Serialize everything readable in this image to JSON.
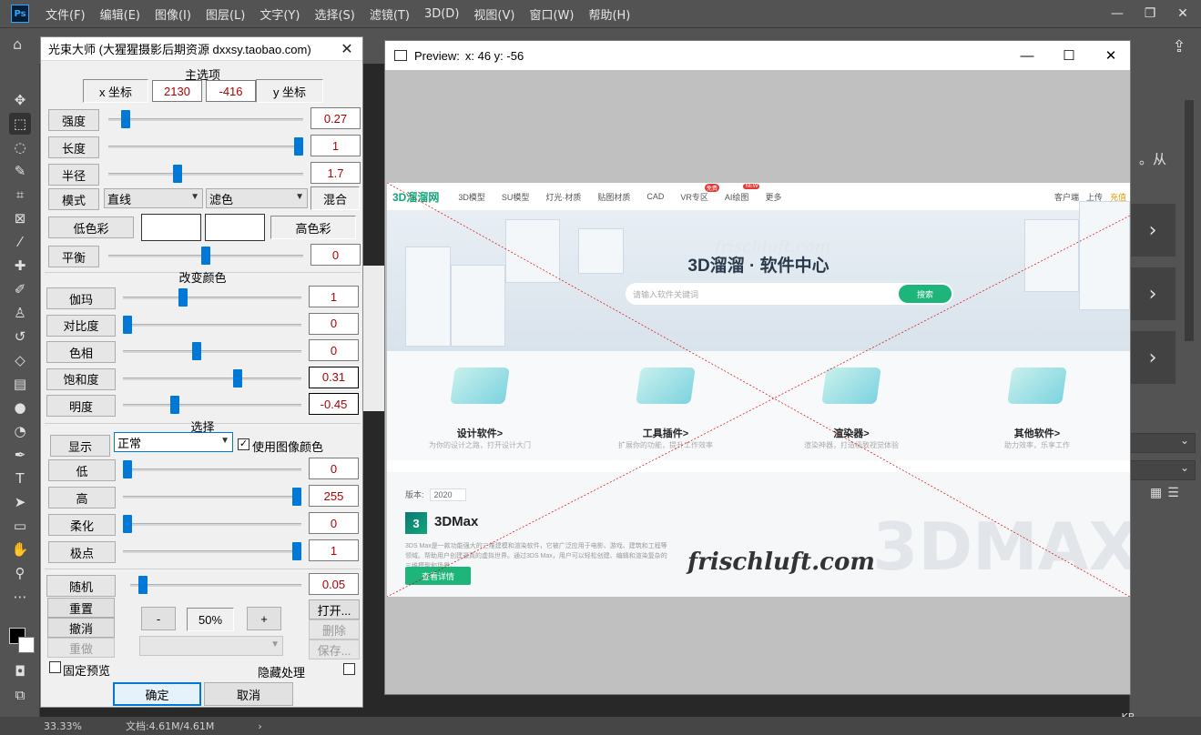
{
  "app": {
    "logo": "Ps",
    "menu": [
      "文件(F)",
      "编辑(E)",
      "图像(I)",
      "图层(L)",
      "文字(Y)",
      "选择(S)",
      "滤镜(T)",
      "3D(D)",
      "视图(V)",
      "窗口(W)",
      "帮助(H)"
    ],
    "window_controls": {
      "minimize": "—",
      "restore": "❐",
      "close": "✕"
    }
  },
  "right_panel": {
    "text": "。从",
    "arrow": "›",
    "kb": "— KB"
  },
  "status": {
    "zoom": "33.33%",
    "doc": "文档:4.61M/4.61M",
    "chevron": "›"
  },
  "dialog": {
    "title": "光束大师 (大猩猩摄影后期资源 dxxsy.taobao.com)",
    "close": "✕",
    "main_section": "主选项",
    "x_label": "x 坐标",
    "x_value": "2130",
    "y_value": "-416",
    "y_label": "y 坐标",
    "params": [
      {
        "label": "强度",
        "value": "0.27",
        "level": 0.07
      },
      {
        "label": "长度",
        "value": "1",
        "level": 1.0
      },
      {
        "label": "半径",
        "value": "1.7",
        "level": 0.35
      }
    ],
    "mode_label": "模式",
    "mode_select": "直线",
    "filter_select": "滤色",
    "mix_label": "混合",
    "low_color_label": "低色彩",
    "high_color_label": "高色彩",
    "balance": {
      "label": "平衡",
      "value": "0",
      "level": 0.5
    },
    "color_section": "改变颜色",
    "color_params": [
      {
        "label": "伽玛",
        "value": "1",
        "level": 0.33
      },
      {
        "label": "对比度",
        "value": "0",
        "level": 0.0
      },
      {
        "label": "色相",
        "value": "0",
        "level": 0.41
      },
      {
        "label": "饱和度",
        "value": "0.31",
        "level": 0.65
      },
      {
        "label": "明度",
        "value": "-0.45",
        "level": 0.28
      }
    ],
    "select_section": "选择",
    "display_label": "显示",
    "display_select": "正常",
    "use_image_color": "使用图像颜色",
    "select_params": [
      {
        "label": "低",
        "value": "0",
        "level": 0.0
      },
      {
        "label": "高",
        "value": "255",
        "level": 1.0
      },
      {
        "label": "柔化",
        "value": "0",
        "level": 0.0
      },
      {
        "label": "极点",
        "value": "1",
        "level": 1.0
      }
    ],
    "random": {
      "label": "随机",
      "value": "0.05",
      "level": 0.05
    },
    "reset": "重置",
    "undo": "撤消",
    "redo": "重做",
    "minus": "-",
    "zoom": "50%",
    "plus": "+",
    "open": "打开...",
    "delete": "删除",
    "save": "保存...",
    "fix_preview": "固定预览",
    "hide_process": "隐藏处理",
    "ok": "确定",
    "cancel": "取消"
  },
  "preview": {
    "title": "Preview:",
    "coords": "x: 46 y: -56",
    "controls": {
      "minimize": "—",
      "maximize": "☐",
      "close": "✕"
    }
  },
  "site": {
    "logo": "3D溜溜网",
    "nav": [
      "3D模型",
      "SU模型",
      "灯光·材质",
      "贴图材质",
      "CAD",
      "VR专区",
      "AI绘图",
      "更多"
    ],
    "badge_vr": "免费",
    "badge_ai": "NEW",
    "nav_right": [
      "客户端",
      "上传",
      "充值"
    ],
    "hero_title": "3D溜溜 · 软件中心",
    "search_placeholder": "请输入软件关键词",
    "search_btn": "搜索",
    "watermark_top": "frischluft.com",
    "categories": [
      {
        "name": "设计软件>",
        "desc": "为你的设计之路，打开设计大门"
      },
      {
        "name": "工具插件>",
        "desc": "扩展你的功能，提升工作效率"
      },
      {
        "name": "渲染器>",
        "desc": "渲染神器，打造极致视觉体验"
      },
      {
        "name": "其他软件>",
        "desc": "助力效率，乐享工作"
      }
    ],
    "version_label": "版本:",
    "version_value": "2020",
    "product_logo": "3",
    "product_name": "3DMax",
    "product_desc": "3DS Max是一款功能强大的三维建模和渲染软件，它被广泛应用于电影、游戏、建筑和工程等领域。帮助用户创建逼真的虚拟世界。通过3DS Max，用户可以轻松创建、编辑和渲染复杂的三维模型和场景。",
    "product_btn": "查看详情",
    "big_mark": "3DMAX",
    "watermark": "frischluft.com"
  }
}
